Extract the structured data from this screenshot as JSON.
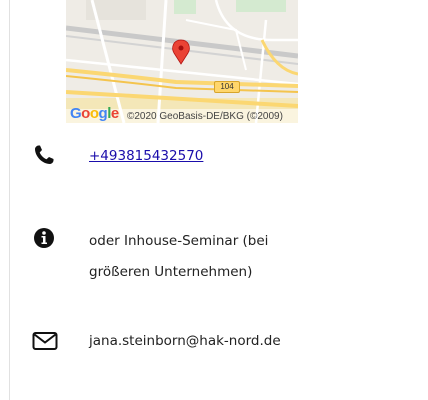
{
  "map": {
    "logo": "Google",
    "copyright": "©2020 GeoBasis-DE/BKG (©2009)",
    "route_number": "104"
  },
  "contact": {
    "phone": {
      "icon": "phone-icon",
      "number": "+493815432570"
    },
    "info": {
      "icon": "info-circle-icon",
      "text": "oder Inhouse-Seminar (bei größeren Unternehmen)"
    },
    "email": {
      "icon": "envelope-icon",
      "address": "jana.steinborn@hak-nord.de"
    }
  },
  "colors": {
    "link": "#1a0dab",
    "marker": "#ea4335",
    "road_major": "#fbd772"
  }
}
